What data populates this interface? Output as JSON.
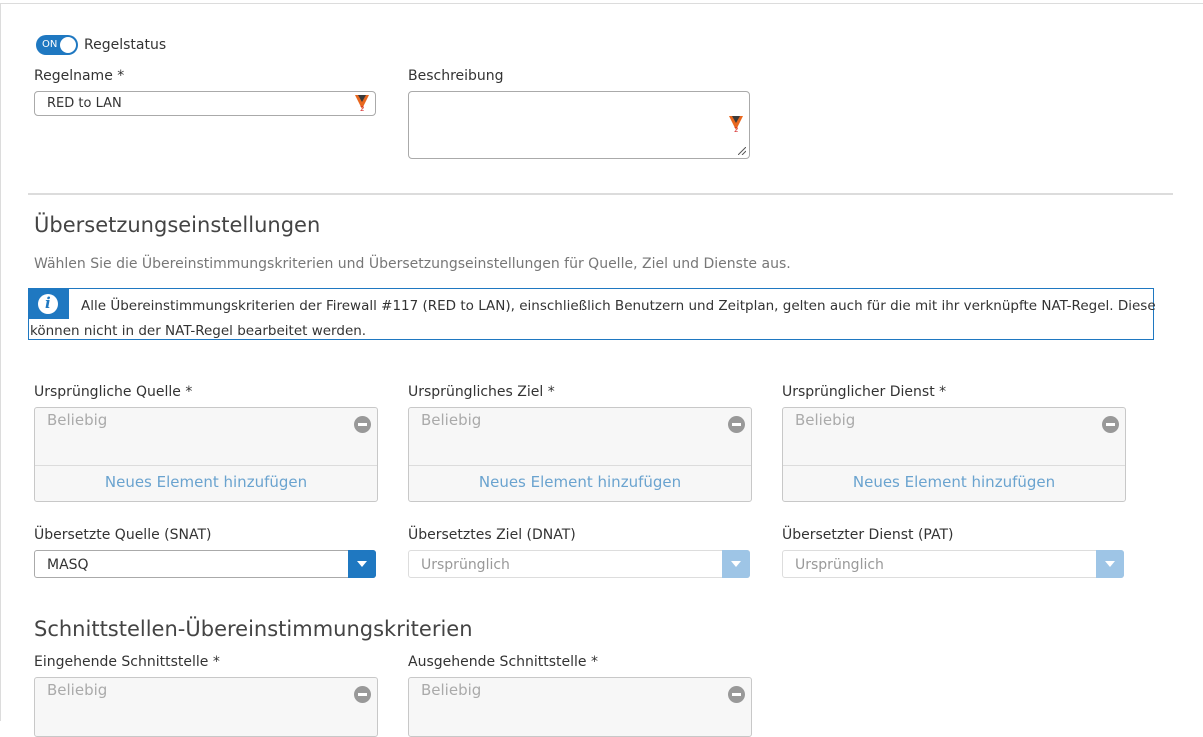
{
  "rule_status": {
    "toggle_text": "ON",
    "label": "Regelstatus"
  },
  "rule_name": {
    "label": "Regelname *",
    "value": "RED to LAN"
  },
  "description": {
    "label": "Beschreibung",
    "value": ""
  },
  "translation": {
    "heading": "Übersetzungseinstellungen",
    "subtitle": "Wählen Sie die Übereinstimmungskriterien und Übersetzungseinstellungen für Quelle, Ziel und Dienste aus.",
    "info_line1": "Alle Übereinstimmungskriterien der Firewall #117 (RED to LAN), einschließlich Benutzern und Zeitplan, gelten auch für die mit ihr verknüpfte NAT-Regel. Diese",
    "info_line2": "können nicht in der NAT-Regel bearbeitet werden.",
    "original_source": {
      "label": "Ursprüngliche Quelle *",
      "placeholder": "Beliebig",
      "add": "Neues Element hinzufügen"
    },
    "original_dest": {
      "label": "Ursprüngliches Ziel *",
      "placeholder": "Beliebig",
      "add": "Neues Element hinzufügen"
    },
    "original_service": {
      "label": "Ursprünglicher Dienst *",
      "placeholder": "Beliebig",
      "add": "Neues Element hinzufügen"
    },
    "snat": {
      "label": "Übersetzte Quelle (SNAT)",
      "value": "MASQ"
    },
    "dnat": {
      "label": "Übersetztes Ziel (DNAT)",
      "value": "Ursprünglich"
    },
    "pat": {
      "label": "Übersetzter Dienst (PAT)",
      "value": "Ursprünglich"
    }
  },
  "interfaces": {
    "heading": "Schnittstellen-Übereinstimmungskriterien",
    "inbound": {
      "label": "Eingehende Schnittstelle *",
      "placeholder": "Beliebig"
    },
    "outbound": {
      "label": "Ausgehende Schnittstelle *",
      "placeholder": "Beliebig"
    }
  },
  "colors": {
    "accent": "#1f78c1",
    "accent_disabled": "#9ec5e6",
    "link": "#6aa3cf"
  }
}
